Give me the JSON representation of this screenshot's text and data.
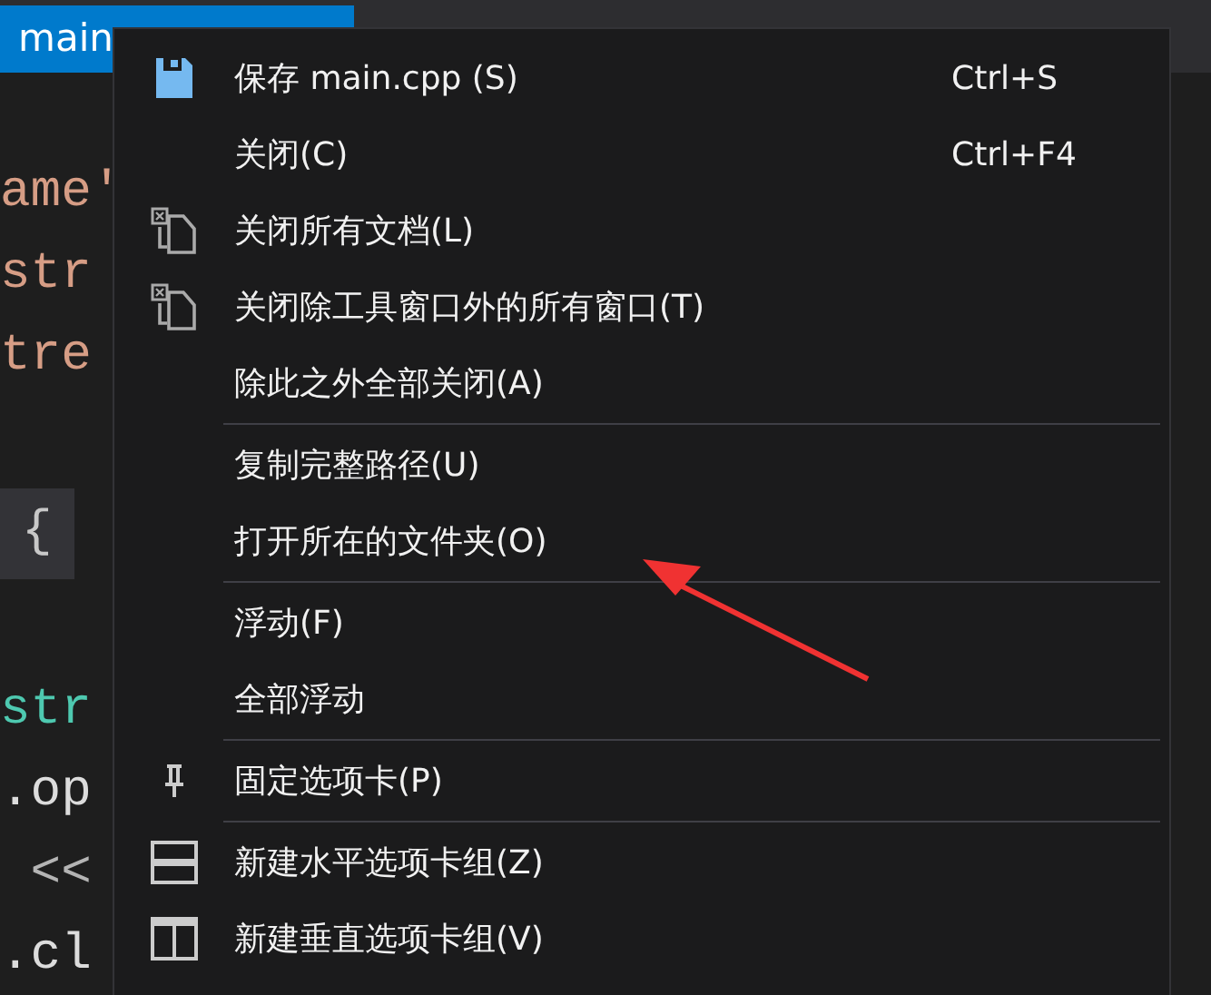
{
  "tab": {
    "label": "main",
    "selected": true
  },
  "code_lines": [
    {
      "text": "ame'",
      "kind": "string"
    },
    {
      "text": "str",
      "kind": "string"
    },
    {
      "text": "tre",
      "kind": "string"
    },
    {
      "text": "{",
      "kind": "brace"
    },
    {
      "text": "str",
      "kind": "type"
    },
    {
      "text": ".op",
      "kind": "plain"
    },
    {
      "text": " <<",
      "kind": "operator"
    },
    {
      "text": ".cl",
      "kind": "plain"
    }
  ],
  "context_menu": {
    "items": [
      {
        "kind": "save",
        "label": "保存 main.cpp (S)",
        "shortcut": "Ctrl+S"
      },
      {
        "kind": "plain",
        "label": "关闭(C)",
        "shortcut": "Ctrl+F4"
      },
      {
        "kind": "close-docs",
        "label": "关闭所有文档(L)"
      },
      {
        "kind": "close-docs",
        "label": "关闭除工具窗口外的所有窗口(T)"
      },
      {
        "kind": "plain",
        "label": "除此之外全部关闭(A)"
      },
      {
        "kind": "separator"
      },
      {
        "kind": "plain",
        "label": "复制完整路径(U)"
      },
      {
        "kind": "plain",
        "label": "打开所在的文件夹(O)"
      },
      {
        "kind": "separator"
      },
      {
        "kind": "plain",
        "label": "浮动(F)"
      },
      {
        "kind": "plain",
        "label": "全部浮动"
      },
      {
        "kind": "separator"
      },
      {
        "kind": "pin",
        "label": "固定选项卡(P)"
      },
      {
        "kind": "separator"
      },
      {
        "kind": "split-h",
        "label": "新建水平选项卡组(Z)"
      },
      {
        "kind": "split-v",
        "label": "新建垂直选项卡组(V)"
      }
    ]
  }
}
